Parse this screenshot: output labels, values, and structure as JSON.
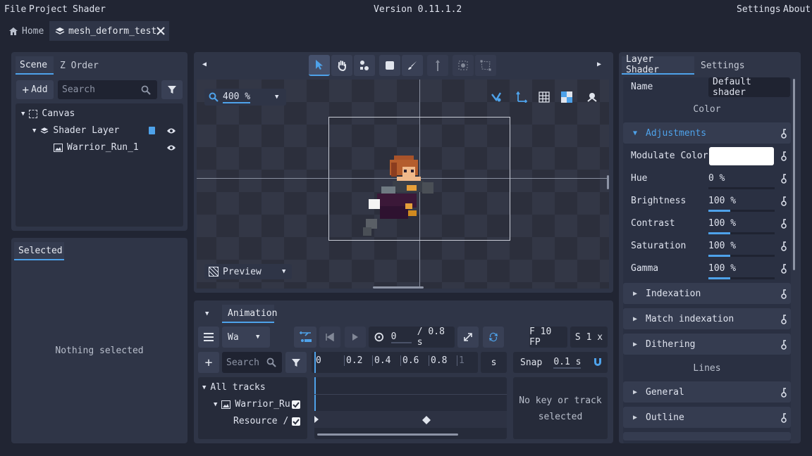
{
  "menu": {
    "file": "File",
    "project": "Project",
    "shader": "Shader",
    "version": "Version 0.11.1.2",
    "settings": "Settings",
    "about": "About"
  },
  "tabs": [
    {
      "label": "Home"
    },
    {
      "label": "mesh_deform_test"
    }
  ],
  "scene": {
    "tabs": [
      "Scene",
      "Z Order"
    ],
    "add_label": "Add",
    "search_placeholder": "Search",
    "tree": [
      {
        "label": "Canvas"
      },
      {
        "label": "Shader Layer"
      },
      {
        "label": "Warrior_Run_1"
      }
    ]
  },
  "selected": {
    "tab": "Selected",
    "empty": "Nothing selected"
  },
  "viewport": {
    "zoom": "400 %",
    "preview": "Preview"
  },
  "animation": {
    "tab": "Animation",
    "anim_name": "Wa",
    "current_time": "0",
    "duration": "/ 0.8 s",
    "fps": "F 10 FP",
    "speed": "S 1 x",
    "search_placeholder": "Search",
    "ruler": [
      "0",
      "0.2",
      "0.4",
      "0.6",
      "0.8",
      "1"
    ],
    "unit": "s",
    "snap_label": "Snap",
    "snap_value": "0.1 s",
    "tracks": [
      {
        "label": "All tracks"
      },
      {
        "label": "Warrior_Ru"
      },
      {
        "label": "Resource /"
      }
    ],
    "no_key": "No key or track selected"
  },
  "shader": {
    "tabs": [
      "Layer Shader",
      "Settings"
    ],
    "name_label": "Name",
    "name_value": "Default shader",
    "color_header": "Color",
    "adjustments": "Adjustments",
    "modulate": "Modulate Color",
    "modulate_color": "#ffffff",
    "params": [
      {
        "label": "Hue",
        "value": "0 %",
        "fill": 0
      },
      {
        "label": "Brightness",
        "value": "100 %",
        "fill": 0.33
      },
      {
        "label": "Contrast",
        "value": "100 %",
        "fill": 0.33
      },
      {
        "label": "Saturation",
        "value": "100 %",
        "fill": 0.33
      },
      {
        "label": "Gamma",
        "value": "100 %",
        "fill": 0.33
      }
    ],
    "sections1": [
      "Indexation",
      "Match indexation",
      "Dithering"
    ],
    "lines_header": "Lines",
    "sections2": [
      "General",
      "Outline"
    ]
  },
  "colors": {
    "accent": "#4ea2ea",
    "panel": "#2f3547",
    "background": "#212533"
  }
}
